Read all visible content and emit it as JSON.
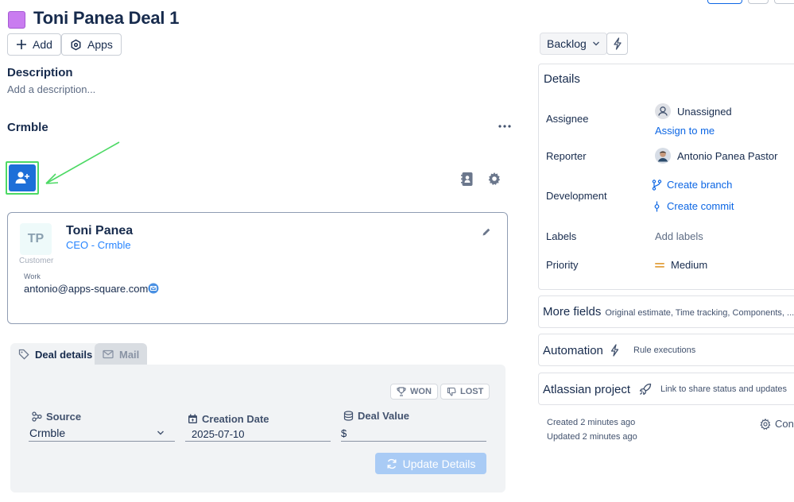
{
  "issue": {
    "title": "Toni Panea Deal 1",
    "add_label": "Add",
    "apps_label": "Apps",
    "description_heading": "Description",
    "description_placeholder": "Add a description..."
  },
  "crmble": {
    "heading": "Crmble",
    "contact": {
      "initials": "TP",
      "type": "Customer",
      "name": "Toni Panea",
      "role": "CEO - Crmble",
      "email_label": "Work",
      "email": "antonio@apps-square.com"
    },
    "tabs": [
      {
        "label": "Deal details"
      },
      {
        "label": "Mail"
      }
    ],
    "won_label": "WON",
    "lost_label": "LOST",
    "source_label": "Source",
    "source_value": "Crmble",
    "creation_date_label": "Creation Date",
    "creation_date_value": "2025-07-10",
    "deal_value_label": "Deal Value",
    "currency_symbol": "$",
    "update_label": "Update Details"
  },
  "sidebar": {
    "status": "Backlog",
    "details_heading": "Details",
    "assignee_label": "Assignee",
    "assignee_value": "Unassigned",
    "assign_to_me": "Assign to me",
    "reporter_label": "Reporter",
    "reporter_value": "Antonio Panea Pastor",
    "development_label": "Development",
    "create_branch": "Create branch",
    "create_commit": "Create commit",
    "labels_label": "Labels",
    "labels_value": "Add labels",
    "priority_label": "Priority",
    "priority_value": "Medium",
    "more_fields_heading": "More fields",
    "more_fields_sub": "Original estimate, Time tracking, Components, ...",
    "automation_heading": "Automation",
    "automation_sub": "Rule executions",
    "atlassian_heading": "Atlassian project",
    "atlassian_sub": "Link to share status and updates",
    "created": "Created 2 minutes ago",
    "updated": "Updated 2 minutes ago",
    "configure_partial": "Con"
  },
  "colors": {
    "accent_blue": "#0c66e4",
    "issue_type": "#c97cf0",
    "highlight_green": "#4cd964",
    "priority_medium": "#e2a03f"
  }
}
